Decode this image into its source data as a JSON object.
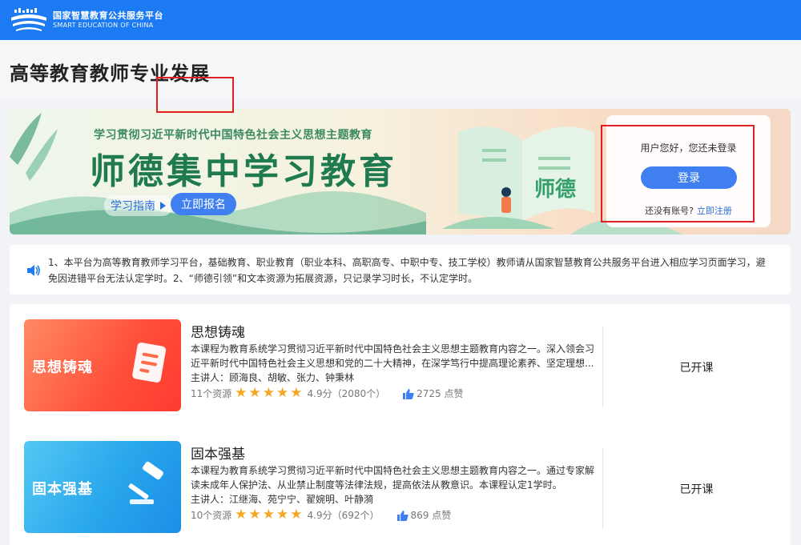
{
  "platform": {
    "name_cn": "国家智慧教育公共服务平台",
    "name_en": "SMART EDUCATION OF CHINA"
  },
  "page_title": "高等教育教师专业发展",
  "banner": {
    "subtitle": "学习贯彻习近平新时代中国特色社会主义思想主题教育",
    "title": "师德集中学习教育",
    "guide_label": "学习指南",
    "enroll_label": "立即报名",
    "book_text": "师德"
  },
  "login": {
    "greeting": "用户您好，您还未登录",
    "login_label": "登录",
    "no_account": "还没有账号?",
    "register_label": "立即注册"
  },
  "notice": {
    "text": "1、本平台为高等教育教师学习平台，基础教育、职业教育（职业本科、高职高专、中职中专、技工学校）教师请从国家智慧教育公共服务平台进入相应学习页面学习，避免因进错平台无法认定学时。2、“师德引领”和文本资源为拓展资源，只记录学习时长，不认定学时。"
  },
  "courses": [
    {
      "cover_label": "思想铸魂",
      "title": "思想铸魂",
      "desc": "本课程为教育系统学习贯彻习近平新时代中国特色社会主义思想主题教育内容之一。深入领会习近平新时代中国特色社会主义思想和党的二十大精神，在深学笃行中提高理论素养、坚定理想...",
      "teachers": "主讲人：顾海良、胡敏、张力、钟秉林",
      "resources": "11个资源",
      "rating": 4.9,
      "rating_text": "4.9分（2080个）",
      "likes": "2725 点赞",
      "status": "已开课",
      "color": "#ff4f3a"
    },
    {
      "cover_label": "固本强基",
      "title": "固本强基",
      "desc": "本课程为教育系统学习贯彻习近平新时代中国特色社会主义思想主题教育内容之一。通过专家解读未成年人保护法、从业禁止制度等法律法规，提高依法从教意识。本课程认定1学时。",
      "teachers": "主讲人：江继海、苑宁宁、翟婉明、叶静漪",
      "resources": "10个资源",
      "rating": 4.9,
      "rating_text": "4.9分（692个）",
      "likes": "869 点赞",
      "status": "已开课",
      "color": "#28a6ec"
    }
  ],
  "colors": {
    "brand": "#1c7bf2",
    "button": "#3f7ff0",
    "highlight_box": "#e02020",
    "star": "#f5a623"
  }
}
